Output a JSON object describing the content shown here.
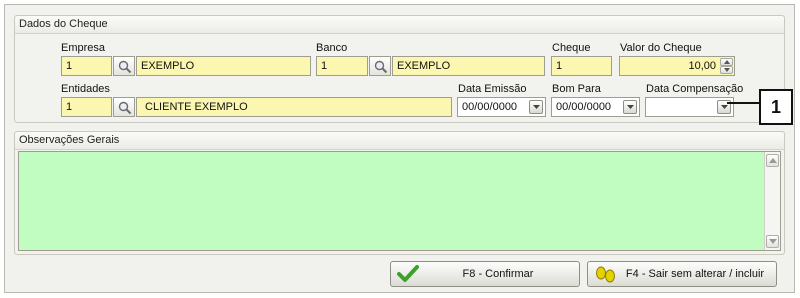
{
  "cheque_group": {
    "title": "Dados do Cheque",
    "empresa": {
      "label": "Empresa",
      "code": "1",
      "name": "EXEMPLO"
    },
    "banco": {
      "label": "Banco",
      "code": "1",
      "name": "EXEMPLO"
    },
    "cheque": {
      "label": "Cheque",
      "value": "1"
    },
    "valor": {
      "label": "Valor do Cheque",
      "value": "10,00"
    },
    "entidades": {
      "label": "Entidades",
      "code": "1",
      "name": "CLIENTE EXEMPLO"
    },
    "data_emissao": {
      "label": "Data Emissão",
      "value": "00/00/0000"
    },
    "bom_para": {
      "label": "Bom Para",
      "value": "00/00/0000"
    },
    "data_compensacao": {
      "label": "Data Compensação",
      "value": ""
    }
  },
  "obs_group": {
    "title": "Observações Gerais",
    "value": ""
  },
  "buttons": {
    "confirm_label": "F8 - Confirmar",
    "exit_label": "F4 - Sair sem alterar / incluir"
  },
  "callout": {
    "number": "1"
  },
  "colors": {
    "field_yellow": "#fbf6b0",
    "memo_green": "#c1fcc1",
    "check_green": "#3aa32a"
  }
}
